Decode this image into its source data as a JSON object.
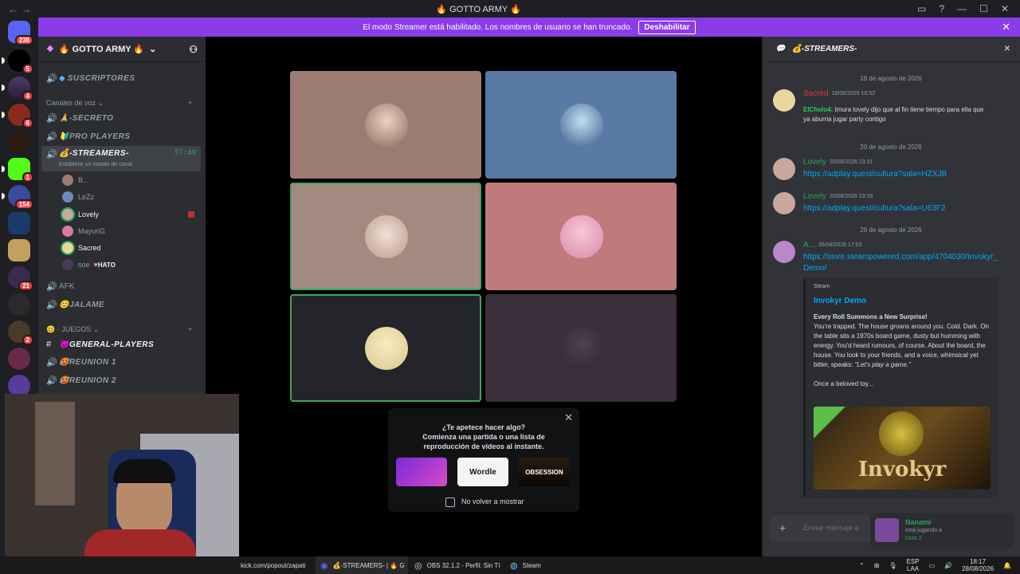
{
  "titlebar": {
    "back": "←",
    "forward": "→",
    "title": "🔥 GOTTO ARMY 🔥"
  },
  "rail": {
    "badges": [
      "238",
      "5",
      "4",
      "6",
      "1",
      "154",
      "21",
      "2"
    ]
  },
  "banner": {
    "text": "El modo Streamer está habilitado. Los nombres de usuario se han truncado.",
    "button": "Deshabilitar"
  },
  "guild": {
    "name": "🔥 GOTTO ARMY 🔥"
  },
  "sidebar": {
    "top_channel": "SUSCRIPTORES",
    "voice_category": "Canales de voz",
    "channels": [
      "🙏-SECRETO",
      "🔰PRO PLAYERS",
      "💰-STREAMERS-"
    ],
    "active_timer": "57:49",
    "status_hint": "Establece un estado de canal",
    "users": [
      "B...",
      "LeZz",
      "Lovely",
      "MayuriG",
      "Sacred",
      "soe"
    ],
    "soe_tag": "HATO",
    "afk": "AFK",
    "jalame": "😊JALAME",
    "games_category": "JUEGOS",
    "general": "👿GENERAL-PLAYERS",
    "reunion1": "🥵REUNION 1",
    "reunion2": "🥵REUNION 2"
  },
  "popup": {
    "title": "¿Te apetece hacer algo?",
    "subtitle": "Comienza una partida o una lista de reproducción de vídeos al instante.",
    "games": [
      "",
      "Wordle",
      "OBSESSION"
    ],
    "checkbox": "No volver a mostrar"
  },
  "chat": {
    "channel": "💰-STREAMERS-",
    "date1": "18 de agosto de 2026",
    "m1_author": "Sacred",
    "m1_time": "18/08/2026 16:52",
    "m1_reply_author": "ElCholo4:",
    "m1_text": "Imura lovely dijo que al fin tiene tiempo para ella que ya aburria jugar party contigo",
    "date2": "20 de agosto de 2026",
    "m2_author": "Lovely",
    "m2_time": "20/08/2026 23:31",
    "m2_link": "https://adplay.quest/cultura?sala=HZXJB",
    "m3_author": "Lovely",
    "m3_time": "20/08/2026 23:39",
    "m3_link": "https://adplay.quest/cultura?sala=U63F2",
    "date3": "26 de agosto de 2026",
    "m4_author": "A...",
    "m4_time": "26/08/2026 17:03",
    "m4_link": "https://store.steampowered.com/app/4704030/Invokyr_Demo/",
    "embed_provider": "Steam",
    "embed_title": "Invokyr Demo",
    "embed_bold": "Every Roll Summons a New Surprise!",
    "embed_desc": "You're trapped. The house groans around you. Cold. Dark. On the table sits a 1970s board game, dusty but humming with energy. You'd heard rumours, of course. About the board, the house. You look to your friends, and a voice, whimsical yet bitter, speaks:",
    "embed_quote": "\"Let's play a game.\"",
    "embed_tail": "Once a beloved toy...",
    "embed_image_text": "Invokyr",
    "compose_placeholder": "Enviar mensaje a",
    "activity_name": "Nanami",
    "activity_line1": "está jugando a",
    "activity_game": "Dota 2"
  },
  "taskbar": {
    "url": "kick.com/popout/zapati",
    "discord": "💰-STREAMERS- | 🔥 G",
    "obs": "OBS 32.1.2 - Perfil: Sin Tí",
    "steam": "Steam",
    "lang1": "ESP",
    "lang2": "LAA",
    "time": "18:17",
    "date": "28/08/2026"
  }
}
